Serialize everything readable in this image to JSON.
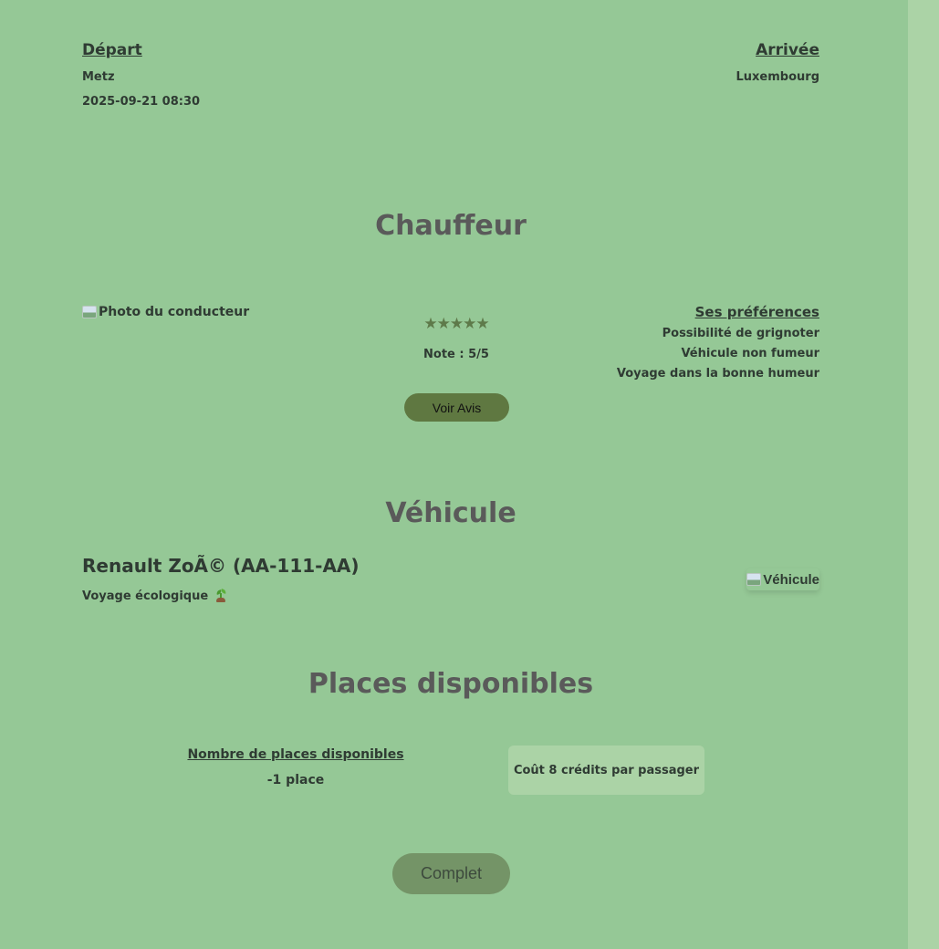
{
  "trip": {
    "departure_label": "Départ",
    "departure_city": "Metz",
    "departure_datetime": "2025-09-21 08:30",
    "arrival_label": "Arrivée",
    "arrival_city": "Luxembourg"
  },
  "driver": {
    "section_title": "Chauffeur",
    "photo_alt": "Photo du conducteur",
    "stars": "★★★★★",
    "rating_value": 5,
    "rating_max": 5,
    "note_text": "Note : 5/5",
    "reviews_button": "Voir Avis",
    "preferences_title": "Ses préférences",
    "preferences": [
      "Possibilité de grignoter",
      "Véhicule non fumeur",
      "Voyage dans la bonne humeur"
    ]
  },
  "vehicle": {
    "section_title": "Véhicule",
    "model": "Renault ZoÃ© (AA-111-AA)",
    "eco_text": "Voyage écologique",
    "eco_icon": "seedling-icon",
    "image_alt": "Véhicule"
  },
  "places": {
    "section_title": "Places disponibles",
    "available_label": "Nombre de places disponibles",
    "available_value": "-1 place",
    "cost_text": "Coût 8 crédits par passager",
    "action_button": "Complet"
  },
  "colors": {
    "background": "#95c896",
    "side_strip": "#abd3a6",
    "button_avis": "#5f7841",
    "button_complet": "#749467",
    "title_text": "#5a5a5a"
  }
}
